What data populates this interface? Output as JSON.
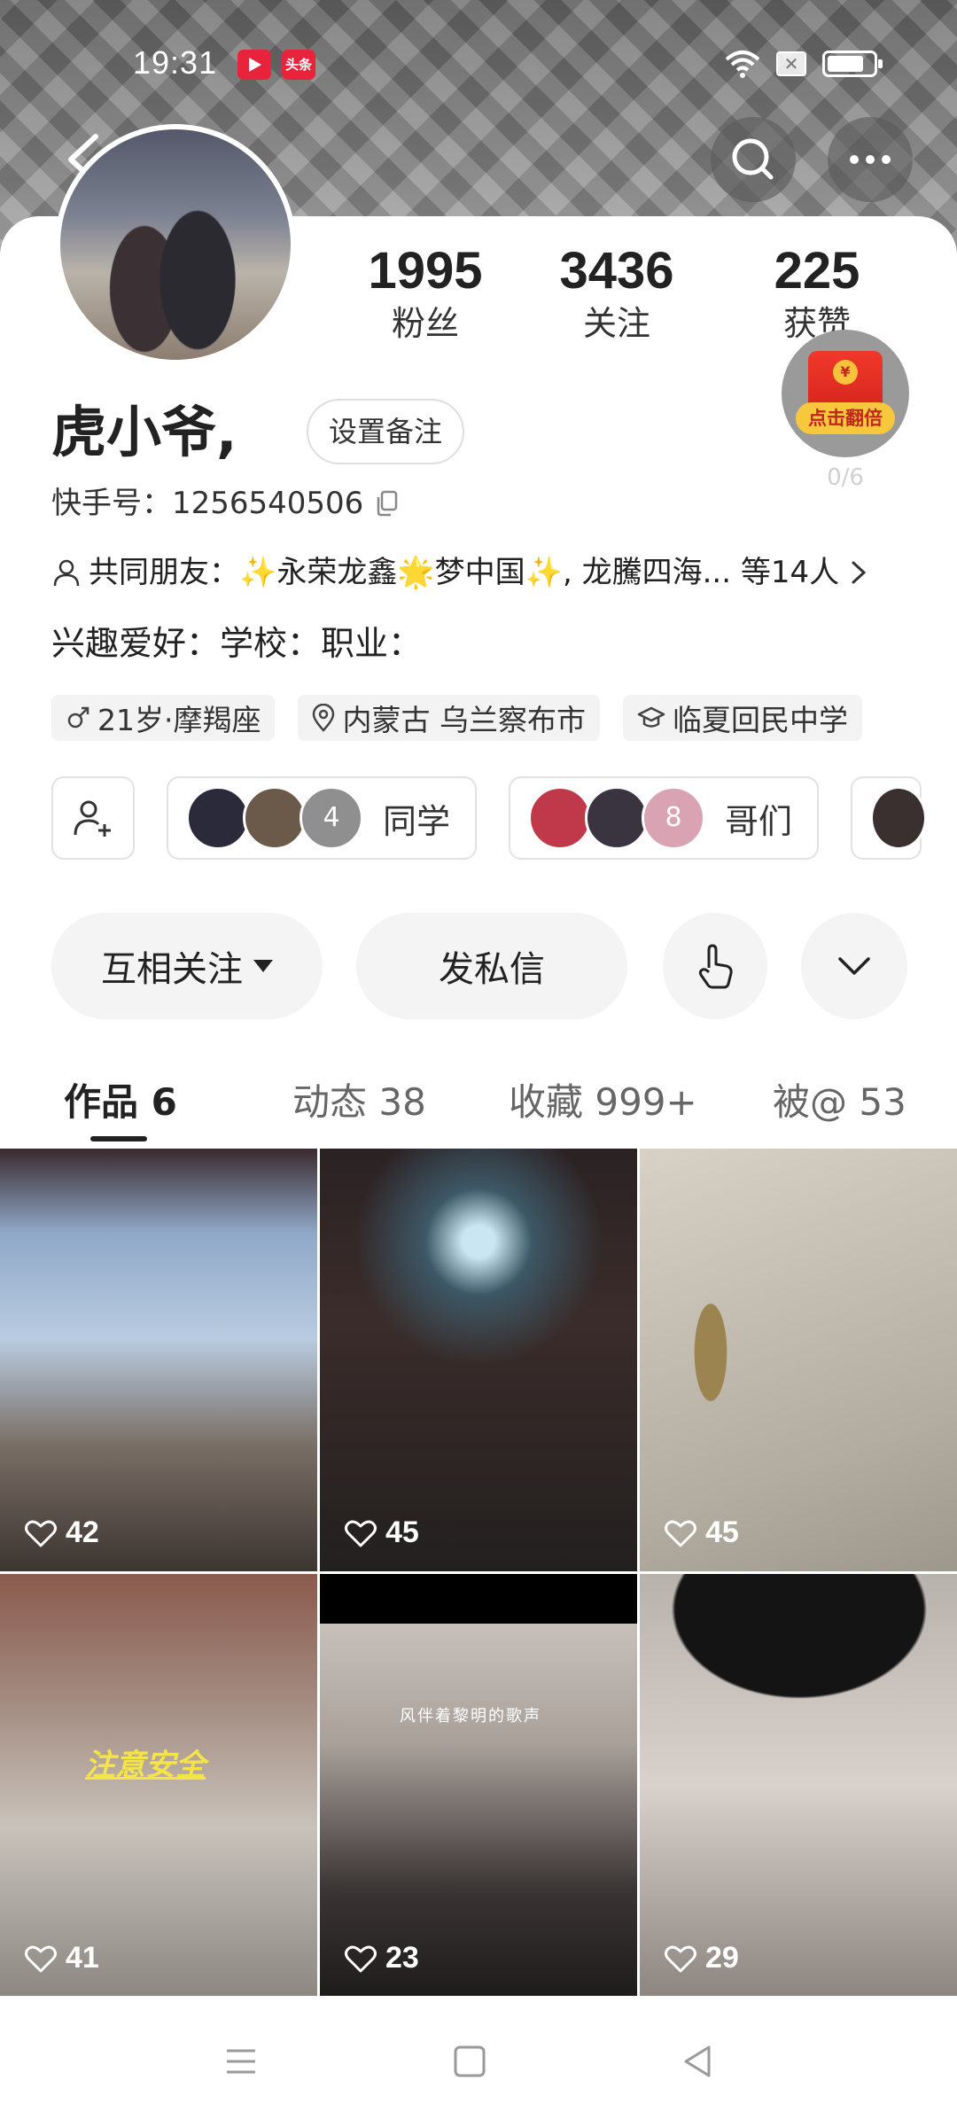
{
  "status_bar": {
    "time": "19:31",
    "news_badge": "头条"
  },
  "profile": {
    "name": "虎小爷,",
    "remark_button": "设置备注",
    "kuaishou_id": "快手号：1256540506",
    "stats": [
      {
        "value": "1995",
        "label": "粉丝"
      },
      {
        "value": "3436",
        "label": "关注"
      },
      {
        "value": "225",
        "label": "获赞"
      }
    ],
    "mutual_friends": "共同朋友：✨永荣龙鑫🌟梦中国✨, 龙騰四海... 等14人",
    "interests": "兴趣爱好：学校：职业：",
    "tags": [
      {
        "icon": "male-icon",
        "text": "21岁·摩羯座"
      },
      {
        "icon": "location-icon",
        "text": "内蒙古 乌兰察布市"
      },
      {
        "icon": "school-icon",
        "text": "临夏回民中学"
      }
    ]
  },
  "red_packet": {
    "label": "点击翻倍",
    "coin": "¥",
    "progress": "0/6"
  },
  "groups": [
    {
      "label": "同学",
      "count": "4",
      "colors": [
        "#2a2a3a",
        "#6b5a4a",
        "#8f8f8f"
      ]
    },
    {
      "label": "哥们",
      "count": "8",
      "colors": [
        "#c0394a",
        "#3a3340",
        "#d9a3b4"
      ]
    }
  ],
  "actions": {
    "follow_label": "互相关注",
    "message_label": "发私信"
  },
  "tabs": [
    {
      "label": "作品 6"
    },
    {
      "label": "动态 38"
    },
    {
      "label": "收藏 999+"
    },
    {
      "label": "被@ 53"
    }
  ],
  "posts": [
    {
      "likes": "42"
    },
    {
      "likes": "45"
    },
    {
      "likes": "45"
    },
    {
      "likes": "41",
      "overlay": "注意安全"
    },
    {
      "likes": "23",
      "overlay": "风伴着黎明的歌声"
    },
    {
      "likes": "29"
    }
  ],
  "colors": {
    "accent_red": "#e8243c",
    "text": "#222222",
    "chip_bg": "#f4f4f4"
  }
}
